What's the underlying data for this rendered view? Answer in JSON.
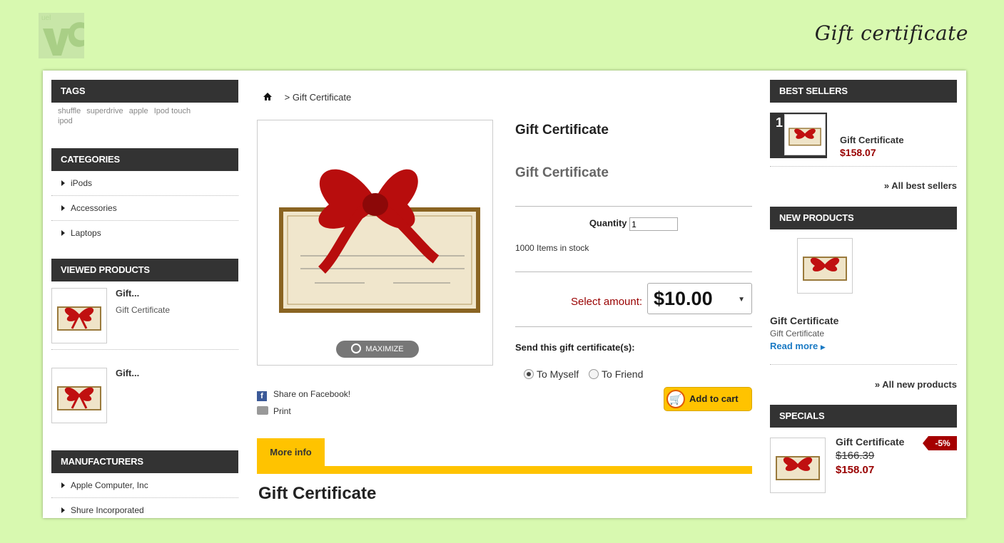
{
  "colors": {
    "background": "#d8f9b0",
    "block_title_bg": "#333333",
    "accent_yellow": "#ffc300",
    "price_red": "#990000",
    "link_blue": "#1a7ac4"
  },
  "header": {
    "title": "Gift certificate",
    "logo_icon": "shop-logo-icon"
  },
  "left": {
    "tags": {
      "title": "TAGS",
      "items": [
        "shuffle",
        "superdrive",
        "apple",
        "Ipod touch",
        "ipod"
      ]
    },
    "categories": {
      "title": "CATEGORIES",
      "items": [
        "iPods",
        "Accessories",
        "Laptops"
      ]
    },
    "viewed": {
      "title": "VIEWED PRODUCTS",
      "items": [
        {
          "name": "Gift...",
          "desc": "Gift Certificate"
        },
        {
          "name": "Gift...",
          "desc": ""
        }
      ]
    },
    "manufacturers": {
      "title": "MANUFACTURERS",
      "items": [
        "Apple Computer, Inc",
        "Shure Incorporated"
      ]
    }
  },
  "product": {
    "breadcrumb": "> Gift Certificate",
    "maximize_label": "MAXIMIZE",
    "share_facebook": "Share on Facebook!",
    "print_label": "Print",
    "title": "Gift Certificate",
    "subtitle": "Gift Certificate",
    "quantity_label": "Quantity",
    "quantity_value": "1",
    "stock_text": "1000 Items in stock",
    "amount_label": "Select amount:",
    "amount_value": "$10.00",
    "send_label": "Send this gift certificate(s):",
    "radio_myself": "To Myself",
    "radio_friend": "To Friend",
    "add_to_cart": "Add to cart",
    "more_info_tab": "More info",
    "section_title": "Gift Certificate"
  },
  "right": {
    "best_sellers": {
      "title": "BEST SELLERS",
      "items": [
        {
          "rank": "1",
          "name": "Gift Certificate",
          "price": "$158.07"
        }
      ],
      "all_link": "» All best sellers"
    },
    "new_products": {
      "title": "NEW PRODUCTS",
      "item": {
        "name": "Gift Certificate",
        "desc": "Gift Certificate",
        "read_more": "Read more"
      },
      "all_link": "» All new products"
    },
    "specials": {
      "title": "SPECIALS",
      "item": {
        "name": "Gift Certificate",
        "old_price": "$166.39",
        "new_price": "$158.07",
        "discount": "-5%"
      }
    }
  }
}
